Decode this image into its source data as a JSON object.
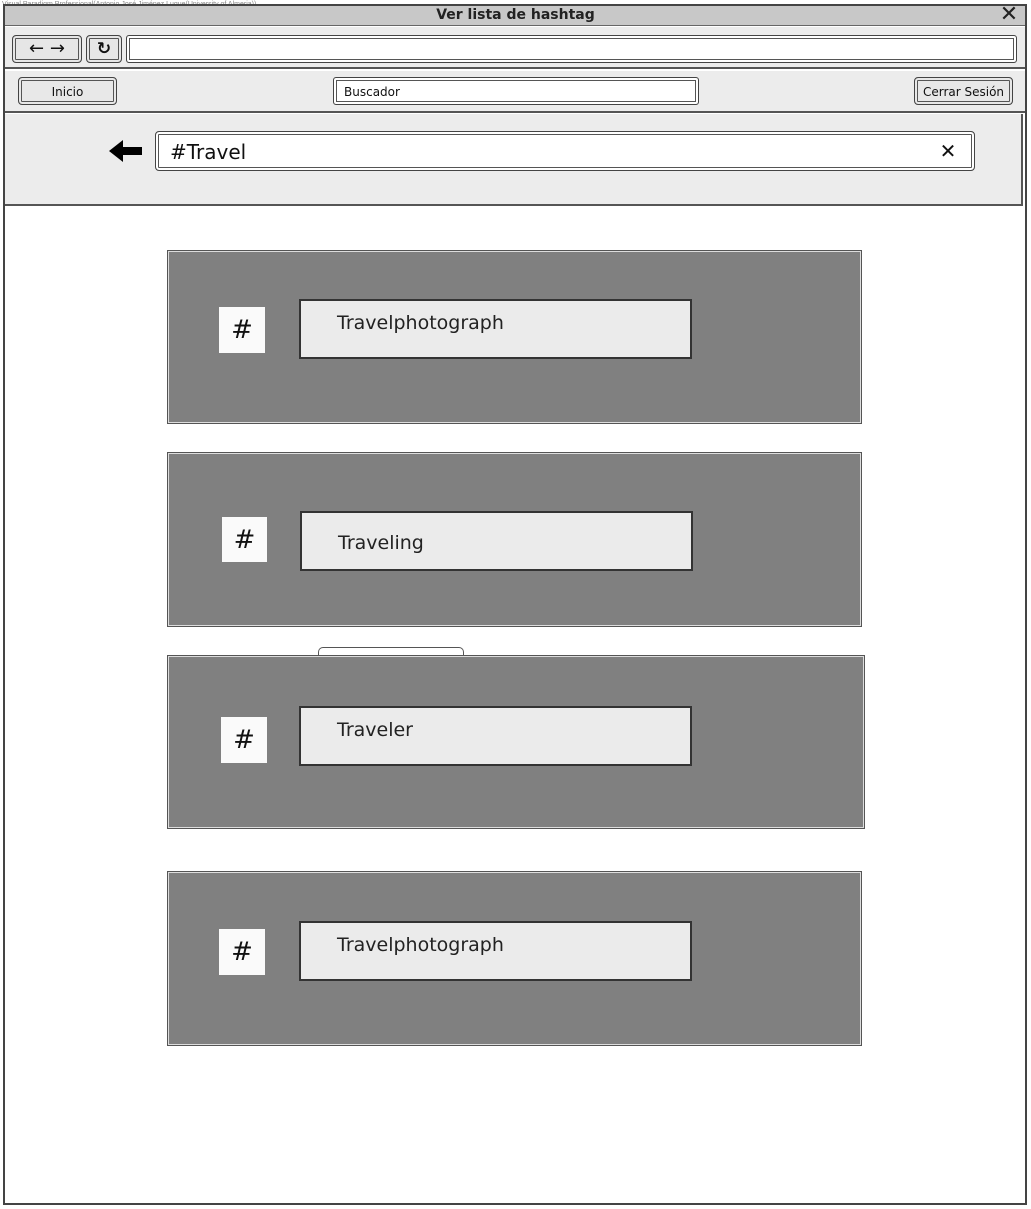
{
  "watermark": "Visual Paradigm Professional(Antonio José Jiménez Luque(University of Almeria))",
  "window": {
    "title": "Ver lista de hashtag",
    "close_icon": "close-icon"
  },
  "browser": {
    "back_forward_glyph": "← →",
    "reload_glyph": "↻",
    "url_value": ""
  },
  "appbar": {
    "inicio_label": "Inicio",
    "search_placeholder": "Buscador",
    "logout_label": "Cerrar Sesión"
  },
  "search": {
    "query": "#Travel",
    "back_icon": "arrow-left-icon",
    "clear_icon": "clear-icon"
  },
  "hashtags": [
    {
      "symbol": "#",
      "label": "Travelphotograph"
    },
    {
      "symbol": "#",
      "label": "Traveling"
    },
    {
      "symbol": "#",
      "label": "Traveler"
    },
    {
      "symbol": "#",
      "label": "Travelphotograph"
    }
  ],
  "colors": {
    "card_bg": "#808080",
    "label_bg": "#ebebeb",
    "panel_bg": "#ececec"
  }
}
